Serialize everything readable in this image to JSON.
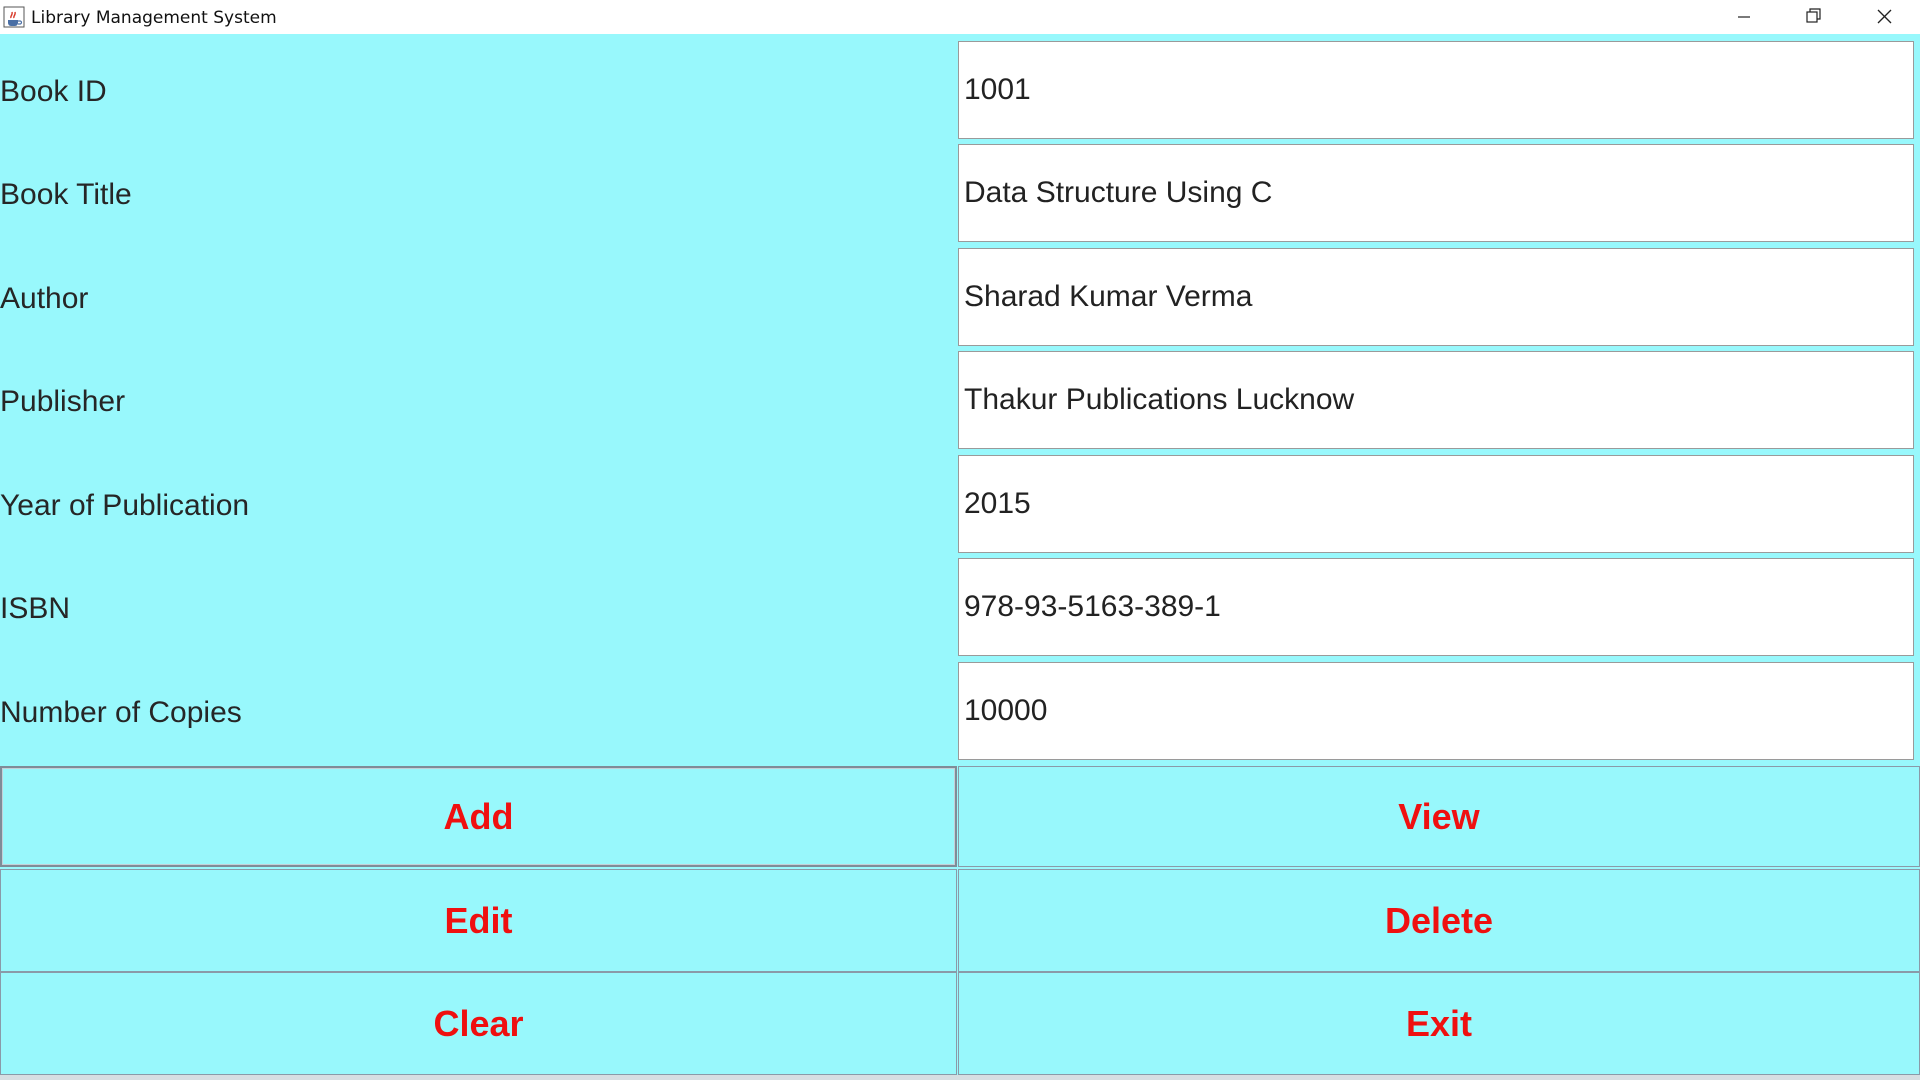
{
  "window": {
    "title": "Library Management System",
    "icons": {
      "app": "java-cup-icon",
      "minimize": "minimize-icon",
      "restore": "restore-icon",
      "close": "close-icon"
    }
  },
  "form": {
    "fields": [
      {
        "label": "Book ID",
        "value": "1001"
      },
      {
        "label": "Book Title",
        "value": "Data Structure Using C"
      },
      {
        "label": "Author",
        "value": "Sharad Kumar Verma"
      },
      {
        "label": "Publisher",
        "value": "Thakur Publications Lucknow"
      },
      {
        "label": "Year of Publication",
        "value": "2015"
      },
      {
        "label": "ISBN",
        "value": "978-93-5163-389-1"
      },
      {
        "label": "Number of Copies",
        "value": "10000"
      }
    ]
  },
  "buttons": {
    "add": "Add",
    "view": "View",
    "edit": "Edit",
    "delete": "Delete",
    "clear": "Clear",
    "exit": "Exit"
  },
  "colors": {
    "background": "#98f8fc",
    "button_text": "#ef1010",
    "label_text": "#262626"
  }
}
